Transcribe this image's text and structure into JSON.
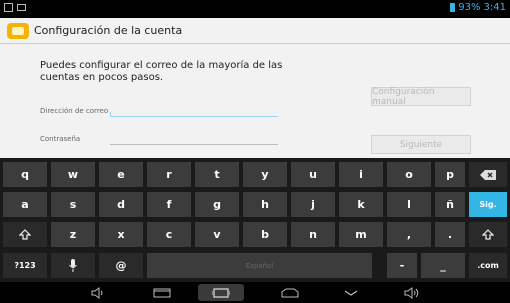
{
  "status": {
    "battery": "93%",
    "time": "3:41"
  },
  "actionbar": {
    "title": "Configuración de la cuenta"
  },
  "form": {
    "intro": "Puedes configurar el correo de la mayoría de las cuentas en pocos pasos.",
    "email_label": "Dirección de correo",
    "password_label": "Contraseña",
    "manual_button": "Configuración manual",
    "next_button": "Siguiente"
  },
  "keyboard": {
    "row1": [
      "q",
      "w",
      "e",
      "r",
      "t",
      "y",
      "u",
      "i",
      "o",
      "p"
    ],
    "row2": [
      "a",
      "s",
      "d",
      "f",
      "g",
      "h",
      "j",
      "k",
      "l",
      "ñ"
    ],
    "row3": [
      "z",
      "x",
      "c",
      "v",
      "b",
      "n",
      "m",
      ",",
      "."
    ],
    "go_label": "Sig.",
    "symbols_label": "?123",
    "at_label": "@",
    "space_label": "Español",
    "dash_label": "-",
    "underscore_label": "_",
    "dotcom_label": ".com"
  },
  "colors": {
    "accent": "#33b5e5",
    "background": "#f2f2f2",
    "keyboard": "#1a1a1a"
  }
}
